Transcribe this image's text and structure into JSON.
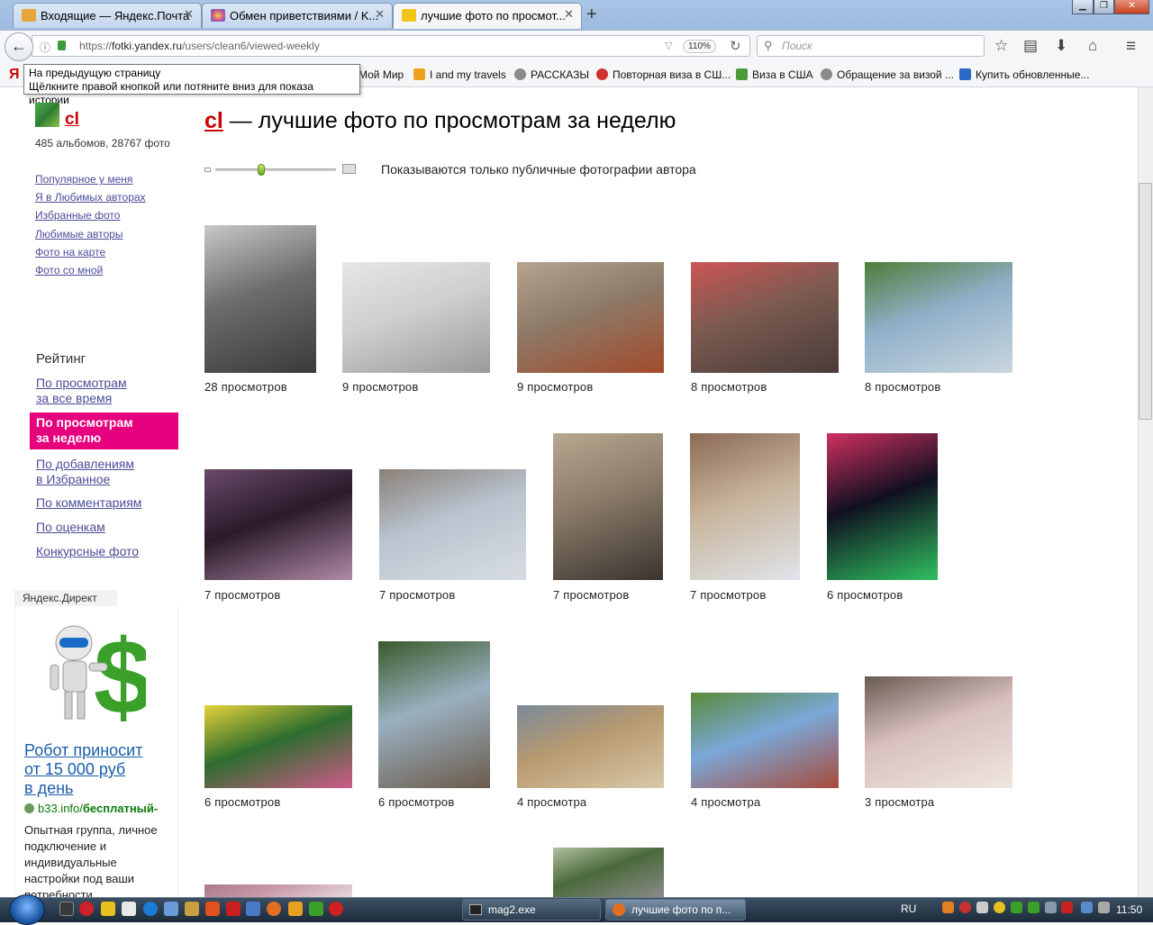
{
  "browser": {
    "tabs": [
      {
        "label": "Входящие — Яндекс.Почта",
        "icon": "mail-icon",
        "color": "#e8a53a"
      },
      {
        "label": "Обмен приветствиями / K...",
        "icon": "flower-icon",
        "color": "#c24f9b"
      },
      {
        "label": "лучшие фото по просмот...",
        "icon": "yandex-fotki-icon",
        "color": "#f0c419"
      }
    ],
    "tab_close": "✕",
    "new_tab": "+",
    "window_buttons": {
      "minimize": "▁",
      "maximize": "❐",
      "close": "✕"
    },
    "url_scheme": "https://",
    "url_domain": "fotki.yandex.ru",
    "url_path": "/users/clean6/viewed-weekly",
    "zoom": "110%",
    "search_placeholder": "Поиск",
    "tooltip_line1": "На предыдущую страницу",
    "tooltip_line2": "Щёлкните правой кнопкой или потяните вниз для показа истории",
    "bookmarks": [
      {
        "label": "Мой Мир"
      },
      {
        "label": "I and my travels"
      },
      {
        "label": "РАССКАЗЫ"
      },
      {
        "label": "Повторная виза в СШ..."
      },
      {
        "label": "Виза в США"
      },
      {
        "label": "Обращение за визой ..."
      },
      {
        "label": "Купить обновленные..."
      }
    ]
  },
  "sidebar": {
    "user_name": "cl",
    "user_stats": "485 альбомов, 28767 фото",
    "links": [
      "Популярное у меня",
      "Я в Любимых авторах",
      "Избранные фото",
      "Любимые авторы",
      "Фото на карте",
      "Фото со мной"
    ],
    "rating_heading": "Рейтинг",
    "rating_links": [
      {
        "line1": "По просмотрам",
        "line2": "за все время"
      },
      {
        "line1": "По просмотрам",
        "line2": "за неделю"
      },
      {
        "line1": "По добавлениям",
        "line2": "в Избранное"
      },
      {
        "line1": "По комментариям",
        "line2": ""
      },
      {
        "line1": "По оценкам",
        "line2": ""
      },
      {
        "line1": "Конкурсные фото",
        "line2": ""
      }
    ],
    "ad": {
      "label": "Яндекс.Директ",
      "title_line1": "Робот приносит",
      "title_line2": "от 15 000 руб",
      "title_line3": "в день",
      "domain": "b33.info/",
      "domain_bold": "бесплатный-",
      "text": "Опытная группа, личное подключение и индивидуальные настройки под ваши потребности"
    }
  },
  "main": {
    "title_user": "cl",
    "title_rest": " — лучшие фото по просмотрам за неделю",
    "notice": "Показываются только публичные фотографии автора",
    "slider_level": 0.37,
    "photos": [
      {
        "caption": "28 просмотров",
        "palette": [
          "#6d6d6d",
          "#c8c8c8",
          "#3a3a3a"
        ]
      },
      {
        "caption": "9 просмотров",
        "palette": [
          "#cfcfcf",
          "#e6e6e6",
          "#9a9a9a"
        ]
      },
      {
        "caption": "9 просмотров",
        "palette": [
          "#8d7a68",
          "#b5a48f",
          "#a24a2a"
        ]
      },
      {
        "caption": "8 просмотров",
        "palette": [
          "#7a5a50",
          "#c55",
          "#4a3b39"
        ]
      },
      {
        "caption": "8 просмотров",
        "palette": [
          "#8fb0c8",
          "#4e7d3a",
          "#c9d6df"
        ]
      },
      {
        "caption": "7 просмотров",
        "palette": [
          "#2a1a2a",
          "#6a4a6a",
          "#b08aa8"
        ]
      },
      {
        "caption": "7 просмотров",
        "palette": [
          "#b9c4cf",
          "#8a8078",
          "#d8dde2"
        ]
      },
      {
        "caption": "7 просмотров",
        "palette": [
          "#8a7a68",
          "#b8a890",
          "#3a3430"
        ]
      },
      {
        "caption": "7 просмотров",
        "palette": [
          "#c7b39a",
          "#8a6a55",
          "#dfe4ea"
        ]
      },
      {
        "caption": "6 просмотров",
        "palette": [
          "#101020",
          "#d03060",
          "#30c060"
        ]
      },
      {
        "caption": "6 просмотров",
        "palette": [
          "#2e6d2e",
          "#e6d23a",
          "#d05a8a"
        ]
      },
      {
        "caption": "6 просмотров",
        "palette": [
          "#9ab0c0",
          "#3a5a2a",
          "#6a5a4a"
        ]
      },
      {
        "caption": "4 просмотра",
        "palette": [
          "#b89a70",
          "#7a8a9a",
          "#d8c8a8"
        ]
      },
      {
        "caption": "4 просмотра",
        "palette": [
          "#7aa8d8",
          "#5a8a3a",
          "#a84a3a"
        ]
      },
      {
        "caption": "3 просмотра",
        "palette": [
          "#d8c0c0",
          "#6a5a50",
          "#f0e6e0"
        ]
      },
      {
        "caption": "",
        "palette": [
          "#c89aa8",
          "#a8788a",
          "#e8d8dc"
        ]
      },
      {
        "caption": "",
        "palette": [
          "#4a6a3a",
          "#b0c0a0",
          "#8a8a8a"
        ]
      }
    ]
  },
  "taskbar": {
    "items": [
      {
        "label": "mag2.exe"
      },
      {
        "label": "лучшие фото по п..."
      }
    ],
    "lang": "RU",
    "clock": "11:50"
  }
}
